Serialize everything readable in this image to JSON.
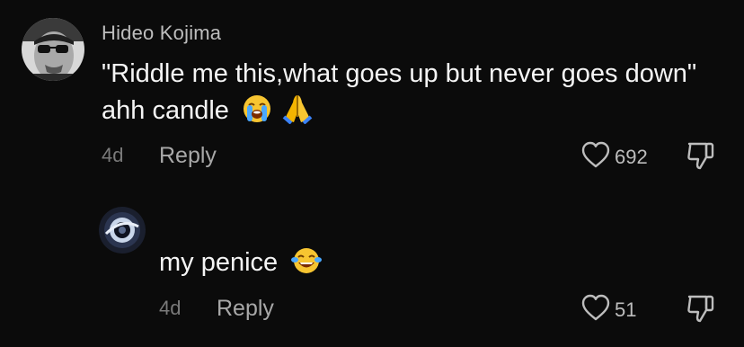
{
  "comment": {
    "username": "Hideo Kojima",
    "text": "\"Riddle me this,what goes up but never goes down\" ahh candle",
    "emojis": [
      "loudly-crying-face",
      "folded-hands"
    ],
    "time": "4d",
    "reply_label": "Reply",
    "likes": "692",
    "avatar_icon": "profile-photo"
  },
  "reply": {
    "text": "my penice",
    "emojis": [
      "face-with-tears-of-joy"
    ],
    "time": "4d",
    "reply_label": "Reply",
    "likes": "51",
    "avatar_icon": "profile-photo"
  },
  "icons": {
    "like": "heart-outline-icon",
    "dislike": "thumbs-down-icon"
  },
  "colors": {
    "background": "#0b0b0b",
    "text": "#f5f5f5",
    "muted": "#7a7a7a"
  }
}
